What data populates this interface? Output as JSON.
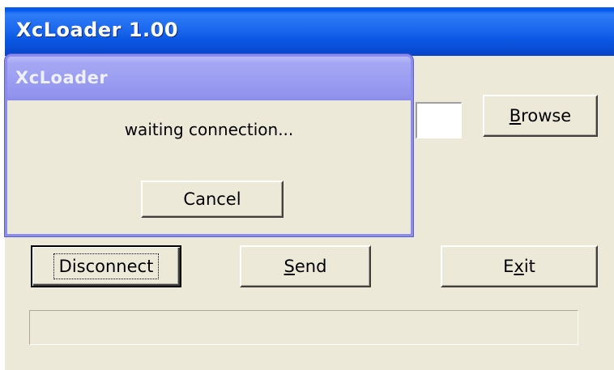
{
  "window": {
    "title": "XcLoader 1.00"
  },
  "main": {
    "browse_label_prefix": "",
    "browse_hotkey": "B",
    "browse_label_rest": "rowse",
    "disconnect_label": "Disconnect",
    "send_hotkey": "S",
    "send_label_rest": "end",
    "exit_label_prefix": "E",
    "exit_hotkey": "x",
    "exit_label_rest": "it",
    "path_value": "",
    "progress_fraction": 0
  },
  "dialog": {
    "title": "XcLoader",
    "message": "waiting connection...",
    "cancel_label": "Cancel"
  },
  "colors": {
    "titlebar": "#0a55e0",
    "dialog_titlebar": "#9c9ef2",
    "face": "#ece9d8"
  }
}
